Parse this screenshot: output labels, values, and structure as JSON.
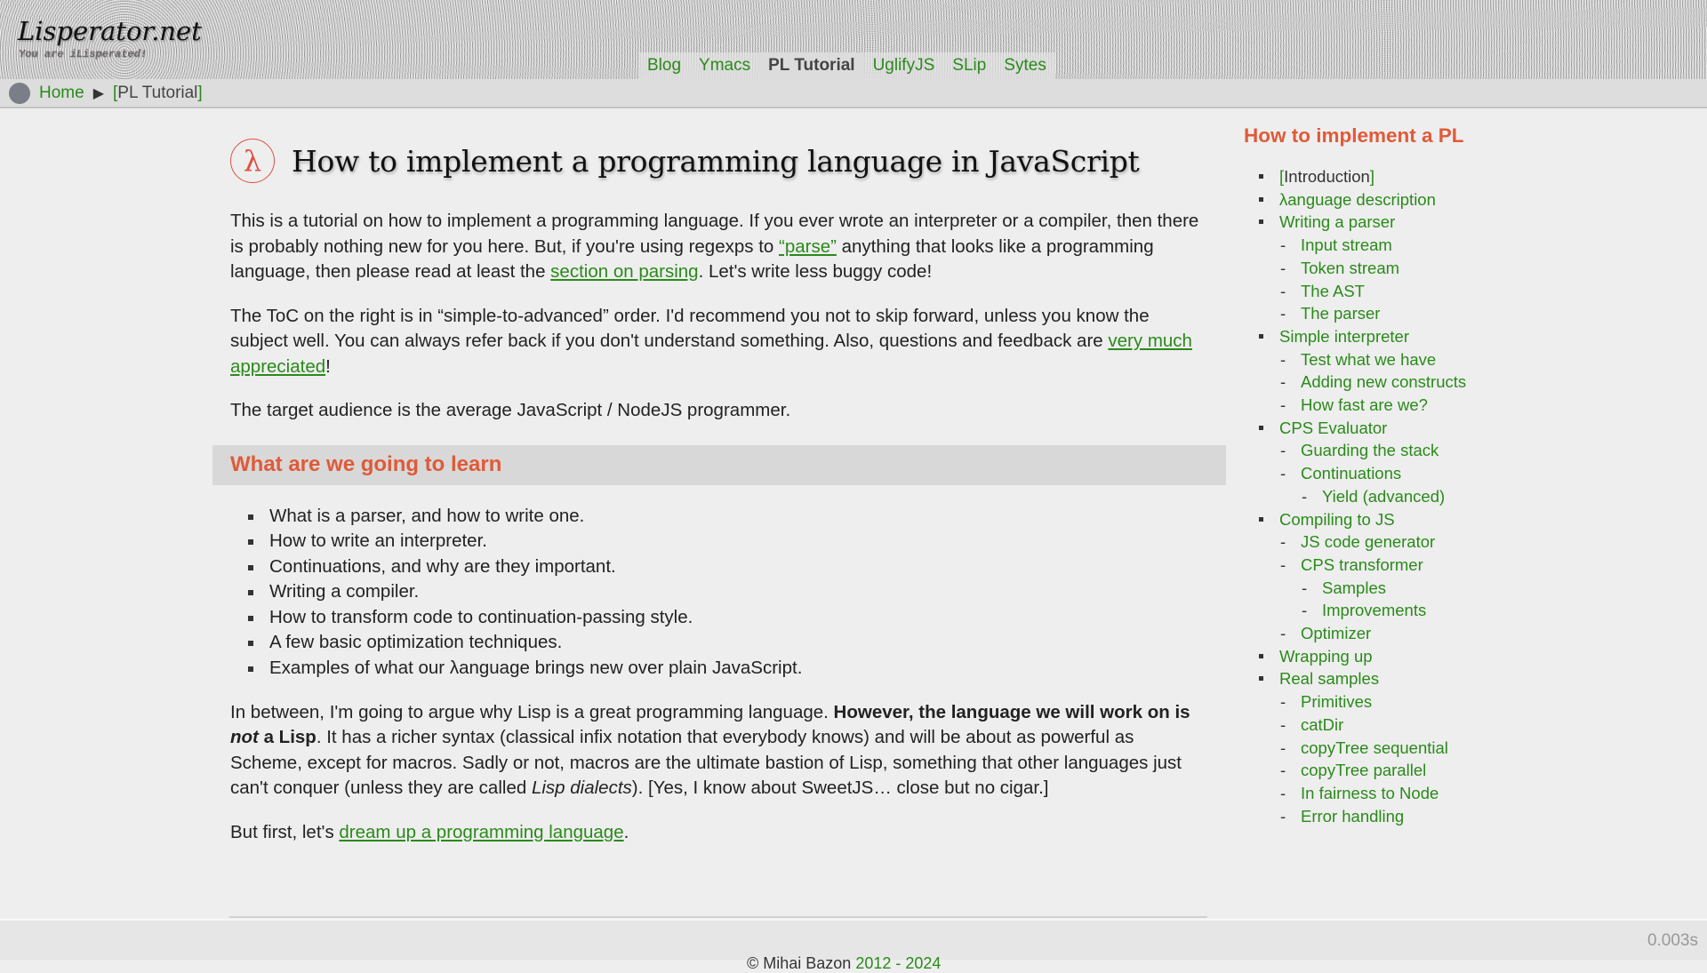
{
  "header": {
    "logo": "Lisperator.net",
    "tagline": "You are iLisperated!",
    "nav": [
      {
        "label": "Blog",
        "active": false
      },
      {
        "label": "Ymacs",
        "active": false
      },
      {
        "label": "PL Tutorial",
        "active": true
      },
      {
        "label": "UglifyJS",
        "active": false
      },
      {
        "label": "SLip",
        "active": false
      },
      {
        "label": "Sytes",
        "active": false
      }
    ]
  },
  "breadcrumb": {
    "home": "Home",
    "separator": "▶",
    "current": "PL Tutorial",
    "bracket_open": "[",
    "bracket_close": "]"
  },
  "main": {
    "badge": "λ",
    "title": "How to implement a programming language in JavaScript",
    "intro": {
      "t1": "This is a tutorial on how to implement a programming language. If you ever wrote an interpreter or a compiler, then there is probably nothing new for you here. But, if you're using regexps to ",
      "link1": "“parse”",
      "t2": " anything that looks like a programming language, then please read at least the ",
      "link2": "section on parsing",
      "t3": ". Let's write less buggy code!"
    },
    "toc_note": {
      "t1": "The ToC on the right is in “simple-to-advanced” order. I'd recommend you not to skip forward, unless you know the subject well. You can always refer back if you don't understand something. Also, questions and feedback are ",
      "link": "very much appreciated",
      "t2": "!"
    },
    "audience": "The target audience is the average JavaScript / NodeJS programmer.",
    "section_heading": "What are we going to learn",
    "learn_items": [
      "What is a parser, and how to write one.",
      "How to write an interpreter.",
      "Continuations, and why are they important.",
      "Writing a compiler.",
      "How to transform code to continuation-passing style.",
      "A few basic optimization techniques.",
      "Examples of what our λanguage brings new over plain JavaScript."
    ],
    "lisp_para": {
      "t1": "In between, I'm going to argue why Lisp is a great programming language. ",
      "b1": "However, the language we will work on is ",
      "bi": "not",
      "b2": " a Lisp",
      "t2": ". It has a richer syntax (classical infix notation that everybody knows) and will be about as powerful as Scheme, except for macros. Sadly or not, macros are the ultimate bastion of Lisp, something that other languages just can't conquer (unless they are called ",
      "i1": "Lisp dialects",
      "t3": "). [Yes, I know about SweetJS… close but no cigar.]"
    },
    "first": {
      "t1": "But first, let's ",
      "link": "dream up a programming language",
      "t2": "."
    }
  },
  "sidebar": {
    "title": "How to implement a PL",
    "toc": [
      {
        "label": "Introduction",
        "level": 1,
        "current": true
      },
      {
        "label": "λanguage description",
        "level": 1
      },
      {
        "label": "Writing a parser",
        "level": 1
      },
      {
        "label": "Input stream",
        "level": 2
      },
      {
        "label": "Token stream",
        "level": 2
      },
      {
        "label": "The AST",
        "level": 2
      },
      {
        "label": "The parser",
        "level": 2
      },
      {
        "label": "Simple interpreter",
        "level": 1
      },
      {
        "label": "Test what we have",
        "level": 2
      },
      {
        "label": "Adding new constructs",
        "level": 2
      },
      {
        "label": "How fast are we?",
        "level": 2
      },
      {
        "label": "CPS Evaluator",
        "level": 1
      },
      {
        "label": "Guarding the stack",
        "level": 2
      },
      {
        "label": "Continuations",
        "level": 2
      },
      {
        "label": "Yield (advanced)",
        "level": 3
      },
      {
        "label": "Compiling to JS",
        "level": 1
      },
      {
        "label": "JS code generator",
        "level": 2
      },
      {
        "label": "CPS transformer",
        "level": 2
      },
      {
        "label": "Samples",
        "level": 3
      },
      {
        "label": "Improvements",
        "level": 3
      },
      {
        "label": "Optimizer",
        "level": 2
      },
      {
        "label": "Wrapping up",
        "level": 1
      },
      {
        "label": "Real samples",
        "level": 1
      },
      {
        "label": "Primitives",
        "level": 2
      },
      {
        "label": "catDir",
        "level": 2
      },
      {
        "label": "copyTree sequential",
        "level": 2
      },
      {
        "label": "copyTree parallel",
        "level": 2
      },
      {
        "label": "In fairness to Node",
        "level": 2
      },
      {
        "label": "Error handling",
        "level": 2
      }
    ]
  },
  "footer": {
    "timing": "0.003s",
    "copyright": "© Mihai Bazon ",
    "years": "2012 - 2024"
  },
  "colors": {
    "link": "#2a8a1a",
    "accent": "#e05a38",
    "text": "#222222",
    "background": "#eeeeee"
  }
}
